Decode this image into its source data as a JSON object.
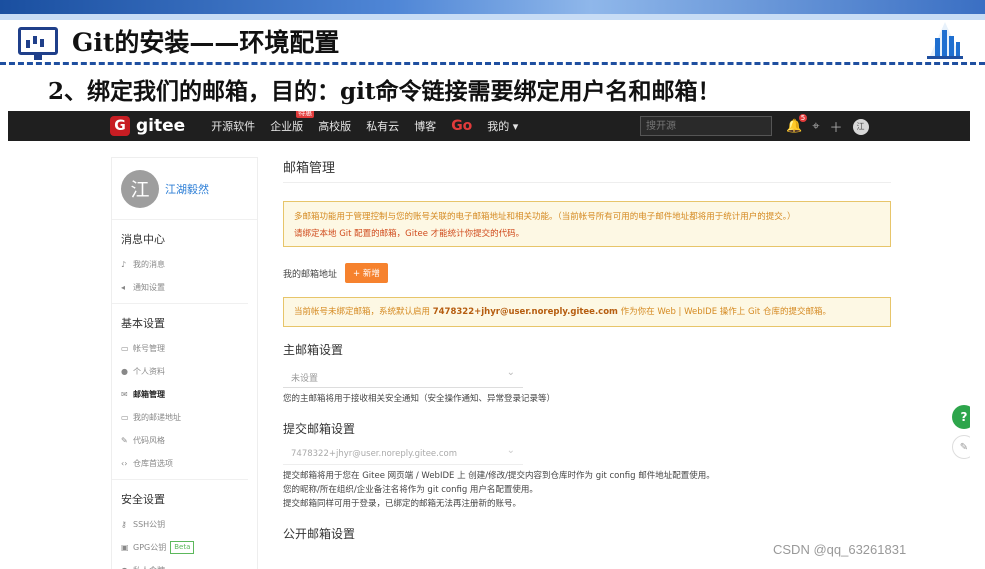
{
  "slide": {
    "title": "Git的安装——环境配置",
    "subtitle": "2、绑定我们的邮箱，目的：git命令链接需要绑定用户名和邮箱！",
    "watermark": "CSDN @qq_63261831"
  },
  "navbar": {
    "logo_letter": "G",
    "logo_text": "gitee",
    "items": [
      "开源软件",
      "企业版",
      "高校版",
      "私有云",
      "博客",
      "Go",
      "我的 ▾"
    ],
    "enterprise_badge": "特惠",
    "search_placeholder": "搜开源",
    "bell_count": "5",
    "icons": [
      "bell-icon",
      "compass-icon",
      "plus-icon",
      "avatar-icon"
    ]
  },
  "sidebar": {
    "avatar_char": "江",
    "user_name": "江湖毅然",
    "groups": [
      {
        "title": "消息中心",
        "items": [
          {
            "icon": "bell-icon",
            "label": "我的消息"
          },
          {
            "icon": "speaker-icon",
            "label": "通知设置"
          }
        ]
      },
      {
        "title": "基本设置",
        "items": [
          {
            "icon": "card-icon",
            "label": "帐号管理"
          },
          {
            "icon": "user-icon",
            "label": "个人资料"
          },
          {
            "icon": "mail-icon",
            "label": "邮箱管理",
            "active": true
          },
          {
            "icon": "card-icon",
            "label": "我的邮递地址"
          },
          {
            "icon": "brush-icon",
            "label": "代码风格"
          },
          {
            "icon": "code-icon",
            "label": "仓库首选项"
          }
        ]
      },
      {
        "title": "安全设置",
        "items": [
          {
            "icon": "key-icon",
            "label": "SSH公钥"
          },
          {
            "icon": "lock-icon",
            "label": "GPG公钥",
            "badge": "Beta"
          },
          {
            "icon": "user-icon",
            "label": "私人令牌"
          }
        ]
      }
    ]
  },
  "main": {
    "title": "邮箱管理",
    "notice1_line1": "多邮箱功能用于管理控制与您的账号关联的电子邮箱地址和相关功能。（当前帐号所有可用的电子邮件地址都将用于统计用户的提交。）",
    "notice1_line2": "请绑定本地 Git 配置的邮箱，Gitee 才能统计你提交的代码。",
    "my_email_label": "我的邮箱地址",
    "add_button": "+ 新增",
    "notice2_prefix": "当前帐号未绑定邮箱，系统默认启用",
    "notice2_email": "7478322+jhyr@user.noreply.gitee.com",
    "notice2_suffix": "作为你在 Web | WebIDE 操作上 Git 仓库的提交邮箱。",
    "primary_title": "主邮箱设置",
    "primary_value": "未设置",
    "primary_help": "您的主邮箱将用于接收相关安全通知（安全操作通知、异常登录记录等）",
    "commit_title": "提交邮箱设置",
    "commit_value": "7478322+jhyr@user.noreply.gitee.com",
    "commit_help1": "提交邮箱将用于您在 Gitee 网页端 / WebIDE 上 创建/修改/提交内容到仓库时作为 git config 邮件地址配置使用。",
    "commit_help2": "您的昵称/所在组织/企业备注名将作为 git config 用户名配置使用。",
    "commit_help3": "提交邮箱同样可用于登录，已绑定的邮箱无法再注册新的账号。",
    "public_title": "公开邮箱设置"
  },
  "floating": {
    "help": "?",
    "feedback_icon": "edit-icon"
  }
}
